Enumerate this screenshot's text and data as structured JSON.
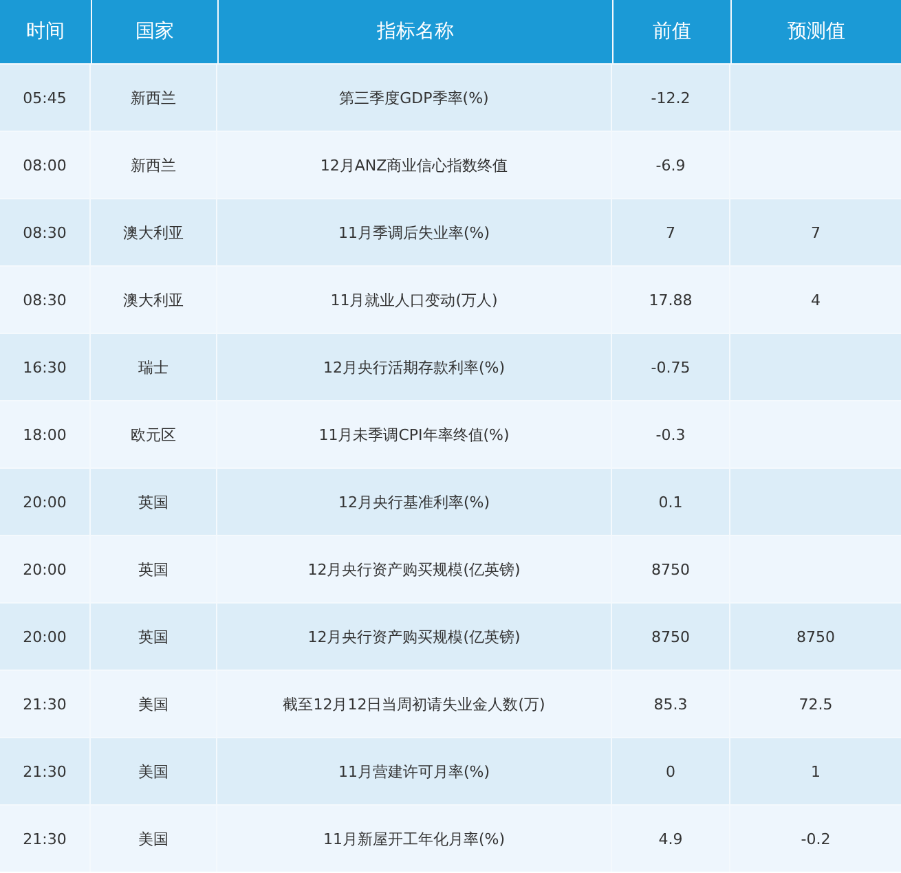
{
  "table": {
    "columns": [
      "时间",
      "国家",
      "指标名称",
      "前值",
      "预测值"
    ],
    "rows": [
      {
        "time": "05:45",
        "country": "新西兰",
        "indicator": "第三季度GDP季率(%)",
        "previous": "-12.2"
      },
      {
        "time": "08:00",
        "country": "新西兰",
        "indicator": "12月ANZ商业信心指数终值",
        "previous": "-6.9"
      },
      {
        "time": "08:30",
        "country": "澳大利亚",
        "indicator": "11月季调后失业率(%)",
        "previous": "7",
        "forecast": "7"
      },
      {
        "time": "08:30",
        "country": "澳大利亚",
        "indicator": "11月就业人口变动(万人)",
        "previous": "17.88",
        "forecast": "4"
      },
      {
        "time": "16:30",
        "country": "瑞士",
        "indicator": "12月央行活期存款利率(%)",
        "previous": "-0.75"
      },
      {
        "time": "18:00",
        "country": "欧元区",
        "indicator": "11月未季调CPI年率终值(%)",
        "previous": "-0.3"
      },
      {
        "time": "20:00",
        "country": "英国",
        "indicator": "12月央行基准利率(%)",
        "previous": "0.1"
      },
      {
        "time": "20:00",
        "country": "英国",
        "indicator": "12月央行资产购买规模(亿英镑)",
        "previous": "8750"
      },
      {
        "time": "20:00",
        "country": "英国",
        "indicator": "12月央行资产购买规模(亿英镑)",
        "previous": "8750",
        "forecast": "8750"
      },
      {
        "time": "21:30",
        "country": "美国",
        "indicator": "截至12月12日当周初请失业金人数(万)",
        "previous": "85.3",
        "forecast": "72.5"
      },
      {
        "time": "21:30",
        "country": "美国",
        "indicator": "11月营建许可月率(%)",
        "previous": "0",
        "forecast": "1"
      },
      {
        "time": "21:30",
        "country": "美国",
        "indicator": "11月新屋开工年化月率(%)",
        "previous": "4.9",
        "forecast": "-0.2"
      }
    ]
  }
}
